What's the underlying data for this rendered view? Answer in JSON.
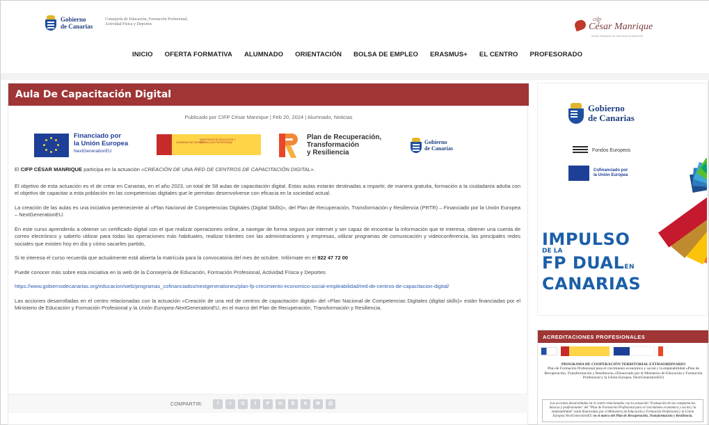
{
  "header": {
    "gobierno_logo_text_1": "Gobierno",
    "gobierno_logo_text_2": "de Canarias",
    "consejeria": "Consejería de Educación, Formación Profesional, Actividad Física y Deportes",
    "cesar_logo_top": "cifp",
    "cesar_logo_name": "César Manrique",
    "cesar_logo_tag": "centro integrado de formación profesional",
    "nav": [
      "INICIO",
      "OFERTA FORMATIVA",
      "ALUMNADO",
      "ORIENTACIÓN",
      "BOLSA DE EMPLEO",
      "ERASMUS+",
      "EL CENTRO",
      "PROFESORADO"
    ]
  },
  "post": {
    "title": "Aula De Capacitación Digital",
    "meta_prefix": "Publicado por",
    "author": "CIFP César Manrique",
    "date": "Feb 20, 2024",
    "categories": "Alumnado, Noticias",
    "logos": {
      "eu_line1": "Financiado por",
      "eu_line2": "la Unión Europea",
      "eu_line3": "NextGenerationEU",
      "esp_gob": "GOBIERNO DE ESPAÑA",
      "esp_min": "MINISTERIO DE EDUCACIÓN Y FORMACIÓN PROFESIONAL",
      "prtr_1": "Plan de Recuperación,",
      "prtr_2": "Transformación",
      "prtr_3": "y Resiliencia",
      "gob_1": "Gobierno",
      "gob_2": "de Canarias"
    },
    "p1_pre": "El",
    "p1_bold": "CIFP CÉSAR MANRIQUE",
    "p1_mid": "participa en la actuación",
    "p1_italic": "«CREACIÓN DE UNA RED DE CENTROS DE CAPACITACIÓN DIGITAL»",
    "p1_end": ".",
    "p2": "El objetivo de esta actuación es el de crear en Canarias, en el año 2023, un total de 58 aulas de capacitación digital. Estas aulas estarán destinadas a impartir, de manera gratuita, formación a la ciudadanía adulta con el objetivo de capacitar a esta población en las competencias digitales que le permitan desenvolverse con eficacia en la sociedad actual.",
    "p3": "La creación de las aulas es una iniciativa perteneciente al «Plan Nacional de Competencias Digitales (Digital Skills)», del Plan de Recuperación, Transformación y Resiliencia (PRTR) – Financiado por la Unión Europea – NextGenerationEU.",
    "p4": "En este curso aprenderás a obtener un certificado digital con el que realizar operaciones online, a navegar de forma segura por internet y ser capaz de encontrar la información que te interesa, obtener una cuenta de correo electrónico y saberlo utilizar para todas las operaciones más habituales, realizar trámites con las administraciones y empresas, utilizar programas de comunicación y videoconferencia, las principales redes sociales que existen hoy en día y cómo sacarles partido,",
    "p5_pre": "Si te interesa el curso recuerda que actualmente está abierta la matrícula para la convocatoria del mes de octubre. Infórmate en el",
    "p5_phone": "922 47 72 00",
    "p6": "Puede conocer más sobre esta iniciativa en la web de la Consejería de Educación, Formación Profesional, Actividad Física y Deportes",
    "link": "https://www.gobiernodecanarias.org/educacion/web/programas_cofinanciados/nextgenerationeu/plan-fp-crecimiento-economico-social-empleabilidad/red-de-centros-de-capacitacion-digital/",
    "p7_a": "Las acciones desarrolladas en el centro relacionadas con la actuación «Creación de una red de centros de capacitación digital» del «Plan Nacional de Competencias Digitales (digital skills)» están financiadas por el Ministerio de Educación y Formación Profesional y la",
    "p7_italic": "Unión Europea-NextGenerationEU",
    "p7_b": ", en el marco del Plan de Recuperación, Transformación y Resiliencia.",
    "share_label": "COMPARTIR:",
    "share_icons": [
      "f",
      "t",
      "G",
      "t",
      "P",
      "in",
      "B",
      "A",
      "✉",
      "⎙"
    ]
  },
  "sidebar": {
    "fp_gob_1": "Gobierno",
    "fp_gob_2": "de Canarias",
    "fondos": "Fondos Europeos",
    "cofin_1": "Cofinanciado por",
    "cofin_2": "la Unión Europea",
    "impulso": "IMPULSO",
    "de_la": "DE LA",
    "fp_dual": "FP DUAL",
    "en": "EN",
    "canarias": "CANARIAS",
    "sdg_colors": [
      "#1e4e8c",
      "#2e7bbf",
      "#3fa7d6",
      "#56c02b",
      "#00a76c",
      "#f99d26",
      "#e5243b",
      "#dd1367",
      "#fd6925",
      "#fcc30b",
      "#bf8b2e",
      "#c5192d"
    ],
    "acred_title": "ACREDITACIONES PROFESIONALES",
    "acred_head": "PROGRAMA DE COOPERACIÓN TERRITORIAL EXTRAORDINARIO",
    "acred_body": "Plan de Formación Profesional para el crecimiento económico y social y la empleabilidad «Plan de Recuperación, Transformación y Resiliencia» (Financiado por el Ministerio de Educación y Formación Profesional y la Unión Europea. NextGenerationEU)",
    "acred_box_pre": "Las acciones desarrolladas en el centro relacionadas con la actuación \"Evaluación de las competencias básicas y profesionales\" del \"Plan de Formación Profesional para el crecimiento económico y social y la empleabilidad\" están financiadas por el Ministerio de Educación y Formación Profesional y la Unión Europea NextGenerationEU",
    "acred_box_bold": "en el marco del Plan de Recuperación, Transformación y Resiliencia."
  }
}
